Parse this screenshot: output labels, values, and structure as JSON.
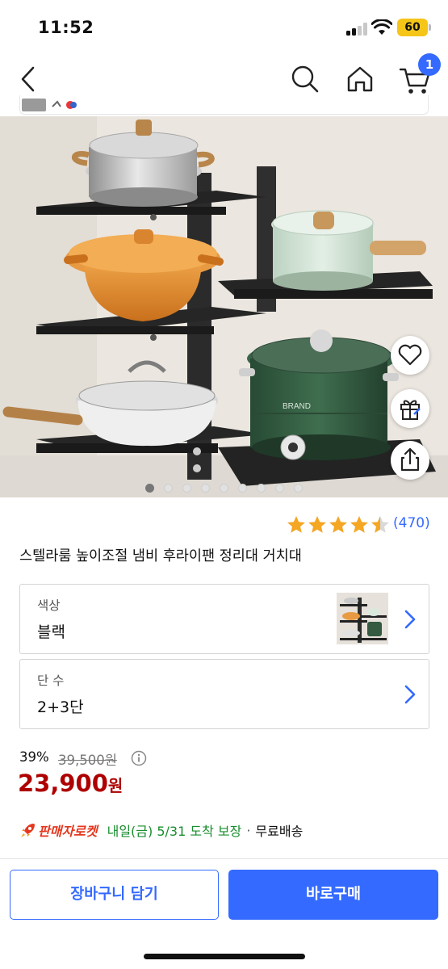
{
  "status_bar": {
    "time": "11:52",
    "battery": "60"
  },
  "header": {
    "cart_count": "1"
  },
  "product": {
    "title": "스텔라룸 높이조절 냄비 후라이팬 정리대 거치대",
    "image_brand": "BRAND",
    "image_count": 9,
    "active_image": 1,
    "rating": 4.5,
    "review_count": "(470)"
  },
  "options": [
    {
      "label": "색상",
      "value": "블랙"
    },
    {
      "label": "단 수",
      "value": "2+3단"
    }
  ],
  "price": {
    "discount": "39%",
    "original": "39,500원",
    "sale_amount": "23,900",
    "sale_unit": "원"
  },
  "delivery": {
    "badge": "판매자로켓",
    "arrival": "내일(금) 5/31 도착 보장",
    "separator": "·",
    "shipping": "무료배송"
  },
  "actions": {
    "add_to_cart": "장바구니 담기",
    "buy_now": "바로구매"
  },
  "colors": {
    "accent": "#346aff",
    "price": "#ae0000",
    "arrival": "#1a8d2f",
    "rocket": "#e4381f",
    "star": "#f5a623"
  },
  "icons": [
    "back-arrow-icon",
    "search-icon",
    "home-icon",
    "cart-icon",
    "heart-icon",
    "gift-icon",
    "share-icon",
    "star-icon",
    "info-icon",
    "rocket-icon",
    "chevron-right-icon"
  ]
}
